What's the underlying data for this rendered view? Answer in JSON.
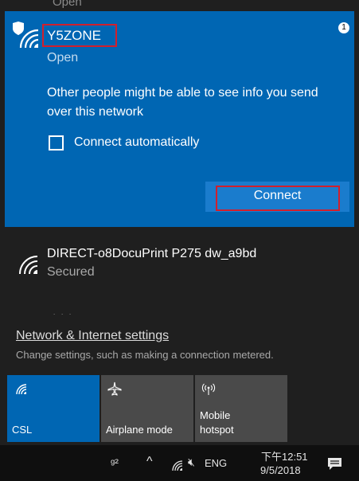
{
  "previous_network": {
    "status_text": "Open"
  },
  "selected_network": {
    "ssid": "Y5ZONE",
    "status": "Open",
    "warning": "Other people might be able to see info you send over this network",
    "auto_connect_label": "Connect automatically",
    "auto_connect_checked": false,
    "connect_label": "Connect"
  },
  "other_network": {
    "name": "DIRECT-o8DocuPrint P275 dw_a9bd",
    "status": "Secured"
  },
  "settings": {
    "link_label": "Network & Internet settings",
    "description": "Change settings, such as making a connection metered."
  },
  "quick_actions": [
    {
      "label": "CSL",
      "icon": "wifi-icon",
      "active": true
    },
    {
      "label": "Airplane mode",
      "icon": "airplane-icon",
      "active": false
    },
    {
      "label": "Mobile hotspot",
      "label_line1": "Mobile",
      "label_line2": "hotspot",
      "icon": "hotspot-icon",
      "active": false
    }
  ],
  "taskbar": {
    "language": "ENG",
    "time": "下午12:51",
    "date": "9/5/2018",
    "notification_count": "1"
  },
  "colors": {
    "selected_bg": "#0066b3",
    "button_bg": "#1a7ccd",
    "highlight_red": "#d21f2c",
    "panel_bg": "#1f1f1f",
    "tile_inactive": "#4a4a4a"
  }
}
